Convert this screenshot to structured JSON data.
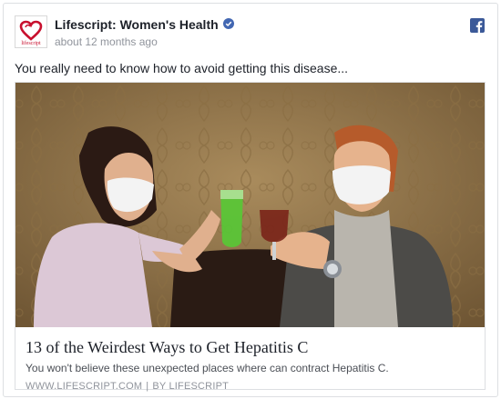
{
  "post": {
    "page_name": "Lifescript: Women's Health",
    "avatar_text": "lifescript",
    "timestamp": "about 12 months ago",
    "message": "You really need to know how to avoid getting this disease..."
  },
  "link": {
    "headline": "13 of the Weirdest Ways to Get Hepatitis C",
    "description": "You won't believe these unexpected places where can contract Hepatitis C.",
    "domain": "WWW.LIFESCRIPT.COM",
    "separator": "|",
    "byline": "BY LIFESCRIPT"
  },
  "icons": {
    "avatar": "lifescript-logo",
    "verified": "verified-badge-icon",
    "network": "facebook-icon"
  },
  "colors": {
    "facebook_blue": "#3b5998",
    "verified_blue": "#4267b2",
    "logo_red": "#c8102e"
  }
}
